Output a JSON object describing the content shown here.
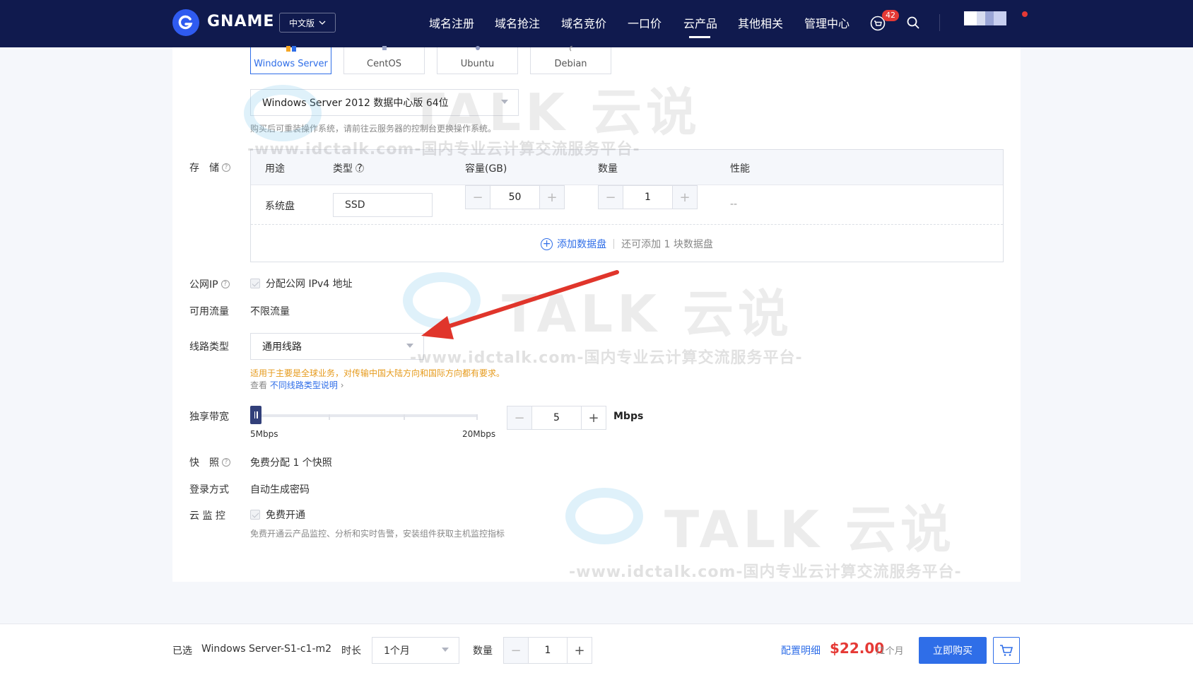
{
  "nav": {
    "brand": "GNAME",
    "lang": "中文版",
    "items": [
      {
        "label": "域名注册"
      },
      {
        "label": "域名抢注"
      },
      {
        "label": "域名竞价"
      },
      {
        "label": "一口价"
      },
      {
        "label": "云产品",
        "active": true
      },
      {
        "label": "其他相关"
      },
      {
        "label": "管理中心"
      }
    ],
    "cart_count": "42"
  },
  "os": {
    "tabs": [
      {
        "label": "Windows Server",
        "active": true
      },
      {
        "label": "CentOS"
      },
      {
        "label": "Ubuntu"
      },
      {
        "label": "Debian"
      }
    ],
    "version": "Windows Server 2012 数据中心版 64位",
    "hint": "购买后可重装操作系统，请前往云服务器的控制台更换操作系统。"
  },
  "storage": {
    "label": "存　储",
    "headers": {
      "usage": "用途",
      "type": "类型",
      "capacity": "容量(GB)",
      "quantity": "数量",
      "performance": "性能"
    },
    "row": {
      "usage": "系统盘",
      "type": "SSD",
      "capacity": "50",
      "quantity": "1",
      "performance": "--"
    },
    "add_disk": "添加数据盘",
    "add_disk_note": "还可添加 1 块数据盘"
  },
  "public_ip": {
    "label": "公网IP",
    "option": "分配公网 IPv4 地址"
  },
  "traffic": {
    "label": "可用流量",
    "value": "不限流量"
  },
  "line_type": {
    "label": "线路类型",
    "value": "通用线路",
    "warning": "适用于主要是全球业务，对传输中国大陆方向和国际方向都有要求。",
    "view_prefix": "查看",
    "view_link": "不同线路类型说明",
    "view_arrow": "›"
  },
  "bandwidth": {
    "label": "独享带宽",
    "min_label": "5Mbps",
    "max_label": "20Mbps",
    "value": "5",
    "level": 0,
    "unit": "Mbps"
  },
  "snapshot": {
    "label": "快　照",
    "value": "免费分配 1 个快照"
  },
  "login": {
    "label": "登录方式",
    "value": "自动生成密码"
  },
  "monitor": {
    "label": "云 监 控",
    "option": "免费开通",
    "hint": "免费开通云产品监控、分析和实时告警，安装组件获取主机监控指标"
  },
  "watermark": {
    "brand": "TALK 云说",
    "url": "-www.idctalk.com-国内专业云计算交流服务平台-"
  },
  "bottom": {
    "selected_label": "已选",
    "selected_value": "Windows Server-S1-c1-m2",
    "duration_label": "时长",
    "duration_value": "1个月",
    "quantity_label": "数量",
    "quantity_value": "1",
    "details_link": "配置明细",
    "price": "$22.00",
    "period": "/1个月",
    "buy_button": "立即购买"
  },
  "colors": {
    "nav_bg": "#101a4e",
    "accent": "#2f6ee8",
    "price": "#e53935",
    "warning": "#e69a1b",
    "arrow": "#e0352b"
  },
  "icons": {
    "cart": "cart-icon",
    "search": "search-icon",
    "help": "help-icon",
    "add": "plus-circle-icon",
    "checkbox": "checkbox-icon",
    "arrow": "red-arrow-annotation"
  }
}
